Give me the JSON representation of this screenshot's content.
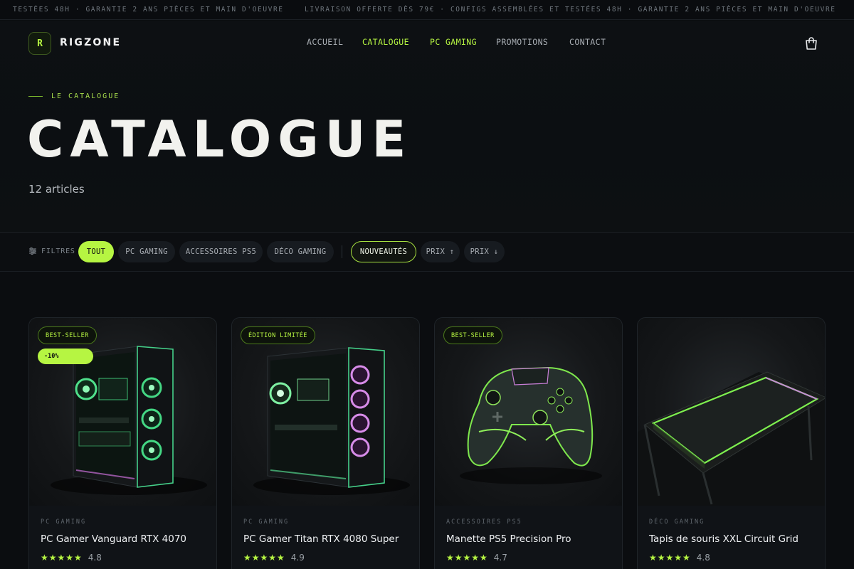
{
  "ticker": {
    "text_left": "TESTÉES 48H · GARANTIE 2 ANS PIÈCES ET MAIN D'OEUVRE",
    "text_right": "LIVRAISON OFFERTE DÈS 79€ · CONFIGS ASSEMBLÉES ET TESTÉES 48H · GARANTIE 2 ANS PIÈCES ET MAIN D'OEUVRE"
  },
  "brand": {
    "logo_letter": "R",
    "name": "RIGZONE"
  },
  "nav": {
    "items": [
      {
        "label": "ACCUEIL",
        "active": false
      },
      {
        "label": "CATALOGUE",
        "active": true
      },
      {
        "label": "PC GAMING",
        "active": true
      },
      {
        "label": "PROMOTIONS",
        "active": false
      },
      {
        "label": "CONTACT",
        "active": false
      }
    ],
    "cart_icon": "shopping-bag-icon"
  },
  "hero": {
    "eyebrow": "LE CATALOGUE",
    "title": "CATALOGUE",
    "count": "12 articles"
  },
  "filters": {
    "label": "FILTRES",
    "categories": [
      {
        "label": "TOUT",
        "active": true
      },
      {
        "label": "PC GAMING",
        "active": false
      },
      {
        "label": "ACCESSOIRES PS5",
        "active": false
      },
      {
        "label": "DÉCO GAMING",
        "active": false
      }
    ],
    "sorts": [
      {
        "label": "NOUVEAUTÉS",
        "active": true
      },
      {
        "label": "PRIX ↑",
        "active": false
      },
      {
        "label": "PRIX ↓",
        "active": false
      }
    ]
  },
  "products": [
    {
      "badge": "BEST-SELLER",
      "discount": "-10%",
      "category": "PC GAMING",
      "name": "PC Gamer Vanguard RTX 4070",
      "stars": "★★★★★",
      "rating": "4.8",
      "rating_value": 4.8
    },
    {
      "badge": "ÉDITION LIMITÉE",
      "category": "PC GAMING",
      "name": "PC Gamer Titan RTX 4080 Super",
      "stars": "★★★★★",
      "rating": "4.9",
      "rating_value": 4.9
    },
    {
      "badge": "BEST-SELLER",
      "category": "ACCESSOIRES PS5",
      "name": "Manette PS5 Precision Pro",
      "stars": "★★★★★",
      "rating": "4.7",
      "rating_value": 4.7
    },
    {
      "category": "DÉCO GAMING",
      "name": "Tapis de souris XXL Circuit Grid",
      "stars": "★★★★★",
      "rating": "4.8",
      "rating_value": 4.8
    }
  ],
  "colors": {
    "accent": "#b6f542",
    "background": "#0b0d10",
    "card": "#101317",
    "text": "#e6e8ea",
    "muted": "#a8adb3"
  }
}
